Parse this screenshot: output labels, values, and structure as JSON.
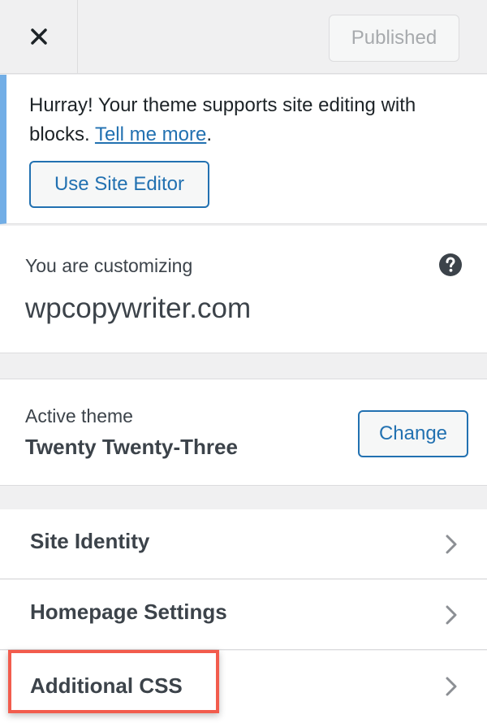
{
  "header": {
    "close_icon": "close-icon",
    "publish_label": "Published"
  },
  "notice": {
    "text_before": "Hurray! Your theme supports site editing with blocks. ",
    "link_text": "Tell me more",
    "text_after": ".",
    "button_label": "Use Site Editor"
  },
  "customizing": {
    "label": "You are customizing",
    "site": "wpcopywriter.com",
    "help_icon": "help-icon"
  },
  "theme": {
    "label": "Active theme",
    "name": "Twenty Twenty-Three",
    "change_label": "Change"
  },
  "menu": {
    "items": [
      {
        "label": "Site Identity"
      },
      {
        "label": "Homepage Settings"
      },
      {
        "label": "Additional CSS",
        "highlighted": true
      }
    ]
  },
  "colors": {
    "accent": "#2271b1",
    "notice_border": "#72aee6",
    "highlight": "#f25c4d"
  }
}
